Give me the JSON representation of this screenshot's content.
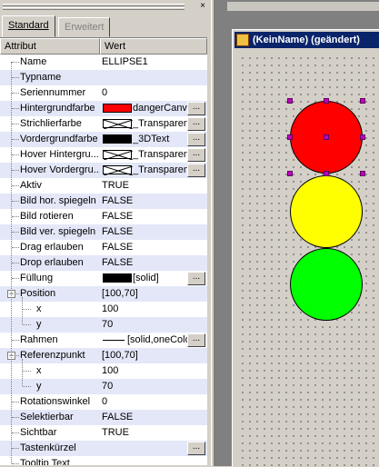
{
  "panel": {
    "tabs": [
      {
        "label": "Standard",
        "active": true
      },
      {
        "label": "Erweitert",
        "active": false
      }
    ],
    "close_glyph": "×",
    "columns": {
      "attribute": "Attribut",
      "value": "Wert"
    },
    "rows": [
      {
        "name": "Name",
        "value": "ELLIPSE1"
      },
      {
        "name": "Typname",
        "value": ""
      },
      {
        "name": "Seriennummer",
        "value": "0"
      },
      {
        "name": "Hintergrundfarbe",
        "value": "dangerCanv",
        "swatch": "#ff0000",
        "button": "..."
      },
      {
        "name": "Strichlierfarbe",
        "value": "_Transparen",
        "swatch": "transparent",
        "button": "..."
      },
      {
        "name": "Vordergrundfarbe",
        "value": "_3DText",
        "swatch": "#000000",
        "button": "..."
      },
      {
        "name": "Hover Hintergru...",
        "value": "_Transparen",
        "swatch": "transparent",
        "button": "..."
      },
      {
        "name": "Hover Vordergru...",
        "value": "_Transparen",
        "swatch": "transparent",
        "button": "..."
      },
      {
        "name": "Aktiv",
        "value": "TRUE"
      },
      {
        "name": "Bild hor. spiegeln",
        "value": "FALSE"
      },
      {
        "name": "Bild rotieren",
        "value": "FALSE"
      },
      {
        "name": "Bild ver. spiegeln",
        "value": "FALSE"
      },
      {
        "name": "Drag erlauben",
        "value": "FALSE"
      },
      {
        "name": "Drop erlauben",
        "value": "FALSE"
      },
      {
        "name": "Füllung",
        "value": "[solid]",
        "swatch": "#000000",
        "button": "..."
      },
      {
        "name": "Position",
        "value": "[100,70]",
        "expander": "−"
      },
      {
        "name": "x",
        "value": "100",
        "child": true
      },
      {
        "name": "y",
        "value": "70",
        "child": true
      },
      {
        "name": "Rahmen",
        "value": "[solid,oneColo",
        "line": true,
        "button": "..."
      },
      {
        "name": "Referenzpunkt",
        "value": "[100,70]",
        "expander": "−"
      },
      {
        "name": "x",
        "value": "100",
        "child": true
      },
      {
        "name": "y",
        "value": "70",
        "child": true
      },
      {
        "name": "Rotationswinkel",
        "value": "0"
      },
      {
        "name": "Selektierbar",
        "value": "FALSE"
      },
      {
        "name": "Sichtbar",
        "value": "TRUE"
      },
      {
        "name": "Tastenkürzel",
        "value": "",
        "button": "..."
      },
      {
        "name": "Tooltip Text",
        "value": ""
      }
    ]
  },
  "window": {
    "title": "(KeinName) (geändert)"
  },
  "colors": {
    "red_light": "#ff0000",
    "yellow_light": "#ffff00",
    "green_light": "#00ff00",
    "title_bar": "#0a246a",
    "handle": "#c000c0"
  }
}
